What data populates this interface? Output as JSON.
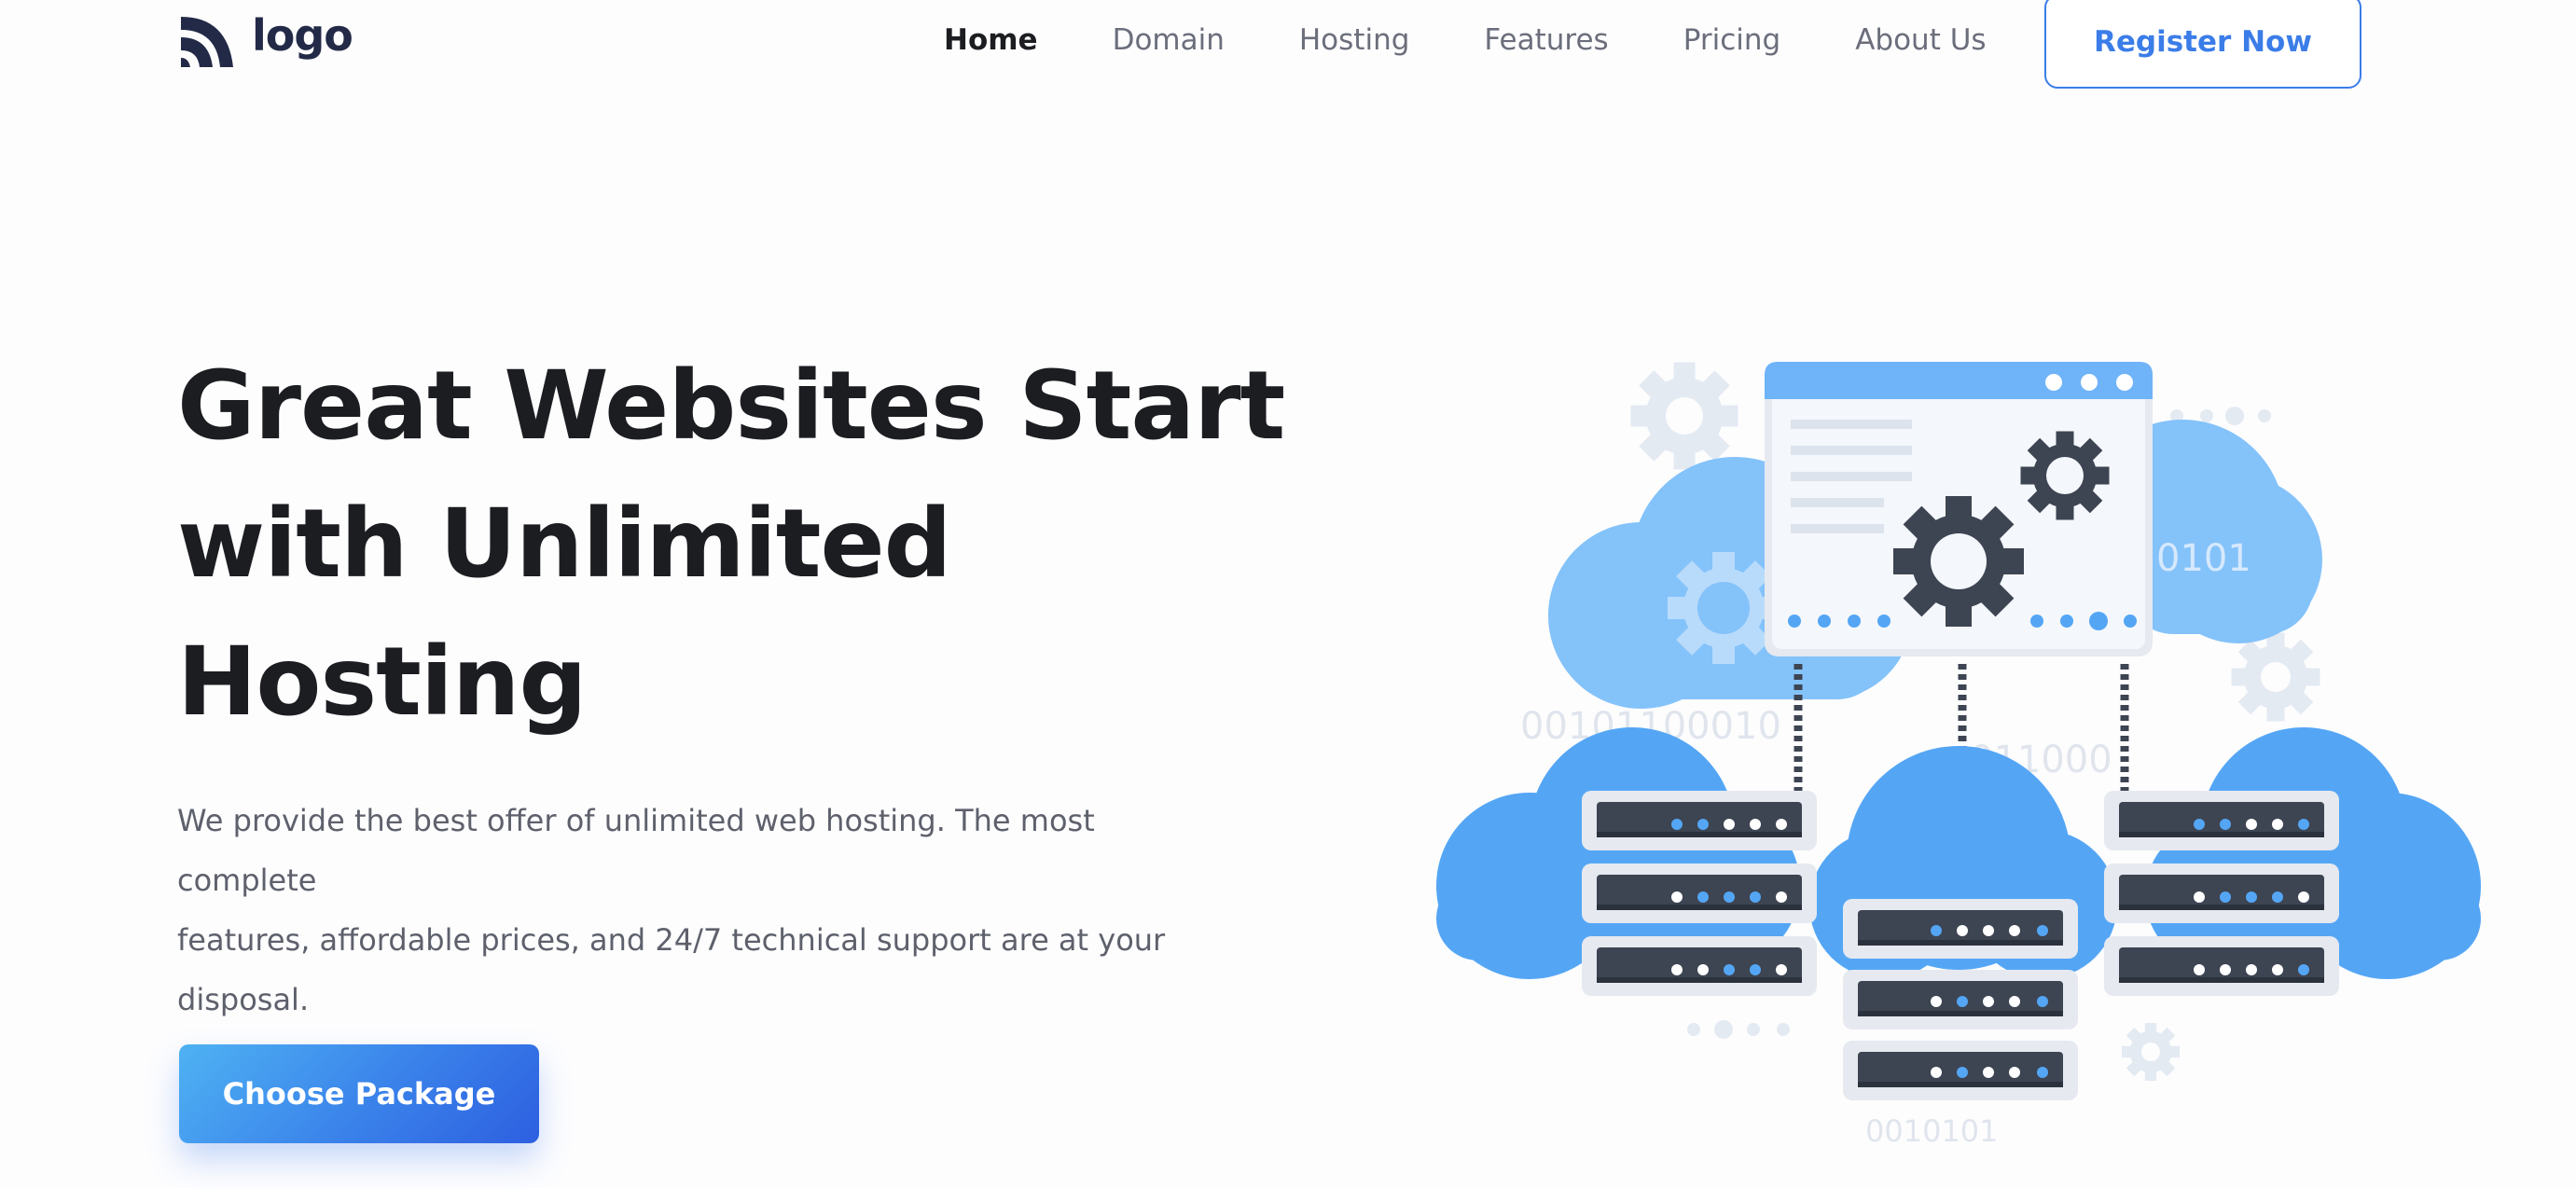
{
  "header": {
    "logo_text": "logo",
    "nav": [
      {
        "label": "Home",
        "active": true
      },
      {
        "label": "Domain",
        "active": false
      },
      {
        "label": "Hosting",
        "active": false
      },
      {
        "label": "Features",
        "active": false
      },
      {
        "label": "Pricing",
        "active": false
      },
      {
        "label": "About Us",
        "active": false
      }
    ],
    "register_label": "Register Now"
  },
  "hero": {
    "title_lines": [
      "Great Websites Start",
      "with Unlimited",
      "Hosting"
    ],
    "description_lines": [
      "We provide the best offer of unlimited web hosting. The most complete",
      "features, affordable prices, and 24/7 technical support are at your",
      "disposal."
    ],
    "cta_label": "Choose Package"
  },
  "illustration": {
    "binary_texts": [
      "0101",
      "00101100010",
      "011000",
      "0010101"
    ]
  },
  "colors": {
    "accent": "#3b7de8",
    "title": "#1c1d21",
    "nav_inactive": "#6b6e7b",
    "cloud_light": "#84c2fa",
    "cloud_main": "#54a6f5",
    "server_dark": "#3d4452"
  }
}
